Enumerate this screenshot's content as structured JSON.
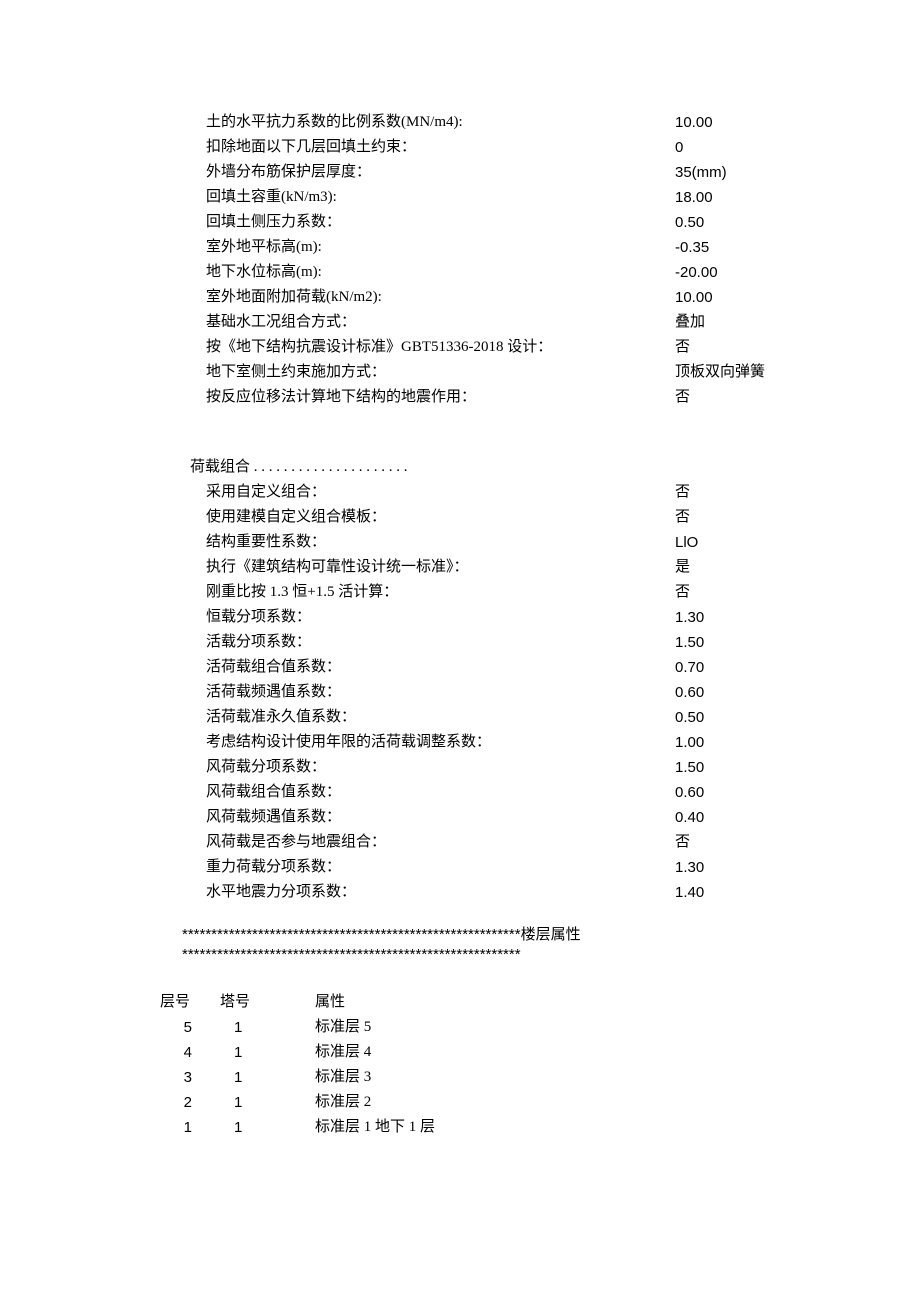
{
  "section1": {
    "rows": [
      {
        "label": "土的水平抗力系数的比例系数(MN/m4):",
        "value": "10.00"
      },
      {
        "label": "扣除地面以下几层回填土约束：",
        "value": "0"
      },
      {
        "label": "外墙分布筋保护层厚度：",
        "value": "35(mm)"
      },
      {
        "label": "回填土容重(kN/m3):",
        "value": "18.00"
      },
      {
        "label": "回填土侧压力系数：",
        "value": "0.50"
      },
      {
        "label": "室外地平标高(m):",
        "value": "-0.35"
      },
      {
        "label": "地下水位标高(m):",
        "value": "-20.00"
      },
      {
        "label": "室外地面附加荷载(kN/m2):",
        "value": "10.00"
      },
      {
        "label": "基础水工况组合方式：",
        "value": "叠加"
      },
      {
        "label": "按《地下结构抗震设计标准》GBT51336-2018 设计：",
        "value": "否"
      },
      {
        "label": "地下室侧土约束施加方式：",
        "value": "顶板双向弹簧"
      },
      {
        "label": "按反应位移法计算地下结构的地震作用：",
        "value": "否"
      }
    ]
  },
  "section2": {
    "header": "荷载组合 . . . . . . . . . . . . . . . . . . . . .",
    "rows": [
      {
        "label": "采用自定义组合：",
        "value": "否"
      },
      {
        "label": "使用建模自定义组合模板：",
        "value": "否"
      },
      {
        "label": "结构重要性系数：",
        "value": "LlO"
      },
      {
        "label": "执行《建筑结构可靠性设计统一标准》：",
        "value": "是"
      },
      {
        "label": "刚重比按 1.3 恒+1.5 活计算：",
        "value": "否"
      },
      {
        "label": "恒载分项系数：",
        "value": "1.30"
      },
      {
        "label": "活载分项系数：",
        "value": "1.50"
      },
      {
        "label": "活荷载组合值系数：",
        "value": "0.70"
      },
      {
        "label": "活荷载频遇值系数：",
        "value": "0.60"
      },
      {
        "label": "活荷载准永久值系数：",
        "value": "0.50"
      },
      {
        "label": "考虑结构设计使用年限的活荷载调整系数：",
        "value": "1.00"
      },
      {
        "label": "风荷载分项系数：",
        "value": "1.50"
      },
      {
        "label": "风荷载组合值系数：",
        "value": "0.60"
      },
      {
        "label": "风荷载频遇值系数：",
        "value": "0.40"
      },
      {
        "label": "风荷载是否参与地震组合：",
        "value": "否"
      },
      {
        "label": "重力荷载分项系数：",
        "value": "1.30"
      },
      {
        "label": "水平地震力分项系数：",
        "value": "1.40"
      }
    ]
  },
  "stars": {
    "line1": "**********************************************************楼层属性",
    "line2": "**********************************************************"
  },
  "table": {
    "headers": {
      "c1": "层号",
      "c2": "塔号",
      "c3": "属性"
    },
    "rows": [
      {
        "c1": "5",
        "c2": "1",
        "c3": "标准层 5"
      },
      {
        "c1": "4",
        "c2": "1",
        "c3": "标准层 4"
      },
      {
        "c1": "3",
        "c2": "1",
        "c3": "标准层 3"
      },
      {
        "c1": "2",
        "c2": "1",
        "c3": "标准层 2"
      },
      {
        "c1": "1",
        "c2": "1",
        "c3": "标准层 1 地下 1 层"
      }
    ]
  }
}
